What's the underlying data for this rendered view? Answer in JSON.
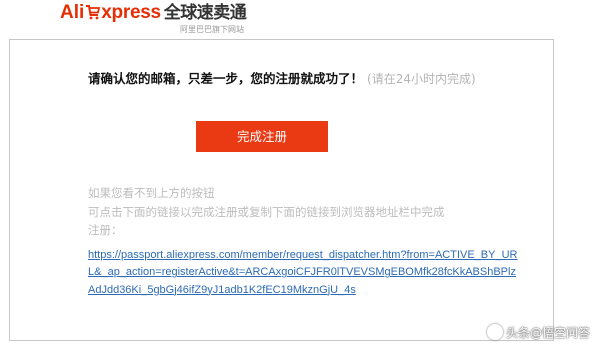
{
  "header": {
    "logo_ali": "Ali",
    "logo_xpress": "xpress",
    "logo_cn": "全球速卖通",
    "logo_sub": "阿里巴巴旗下网站"
  },
  "message": {
    "headline": "请确认您的邮箱，只差一步，您的注册就成功了！",
    "hint": "(请在24小时内完成)"
  },
  "complete_button": {
    "label": "完成注册"
  },
  "fallback": {
    "line1": "如果您看不到上方的按钮",
    "line2": "可点击下面的链接以完成注册或复制下面的链接到浏览器地址栏中完成",
    "line3": "注册："
  },
  "activation_link": "https://passport.aliexpress.com/member/request_dispatcher.htm?from=ACTIVE_BY_URL&_ap_action=registerActive&t=ARCAxgoiCFJFR0lTVEVSMgEBOMfk28fcKkABShBPlzAdJdd36Ki_5gbGj46ifZ9yJ1adb1K2fEC19MkznGjU_4s",
  "watermark": {
    "text": "头条@悟空问答"
  },
  "colors": {
    "brand": "#e62e04",
    "button": "#ea3a14",
    "link": "#2d6bb6",
    "muted_text": "#bdbdbd"
  }
}
